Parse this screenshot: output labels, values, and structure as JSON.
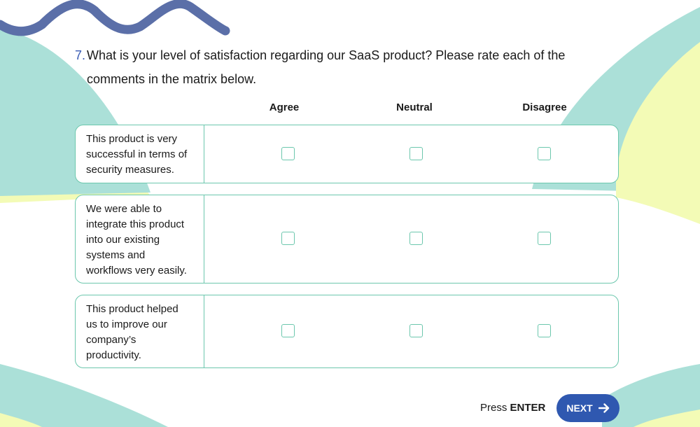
{
  "question": {
    "number": "7.",
    "text_line1": "What is your level of satisfaction regarding our SaaS product? Please rate each of the",
    "text_line2": "comments in the matrix below."
  },
  "columns": [
    "Agree",
    "Neutral",
    "Disagree"
  ],
  "rows": [
    {
      "lines": [
        "This product is very",
        "successful in terms of",
        "security measures."
      ],
      "checked": [
        false,
        false,
        false
      ]
    },
    {
      "lines": [
        "We were able to",
        "integrate this product",
        "into our existing",
        "systems and",
        "workflows very easily."
      ],
      "checked": [
        false,
        false,
        false
      ]
    },
    {
      "lines": [
        "This product helped",
        "us to improve our",
        "company’s",
        "productivity."
      ],
      "checked": [
        false,
        false,
        false
      ]
    }
  ],
  "footer": {
    "press_label": "Press",
    "key_label": "ENTER",
    "next_label": "NEXT",
    "next_icon": "arrow-right-icon"
  },
  "colors": {
    "accent_blue": "#2f58b0",
    "question_number": "#3a5cb5",
    "checkbox_border": "#6cc7ad",
    "teal_shape": "#abe0d8",
    "yellow_shape": "#f3fbb6",
    "wave": "#5b6fa8"
  }
}
